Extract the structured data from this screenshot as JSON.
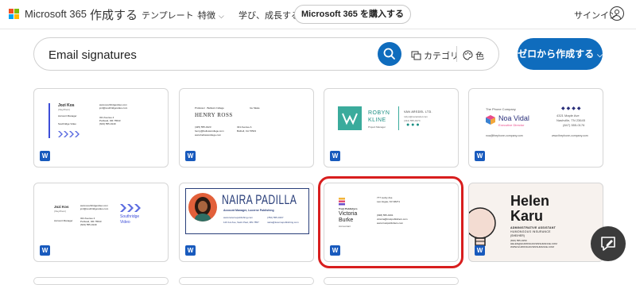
{
  "topbar": {
    "brand": "Microsoft 365",
    "create": "作成する",
    "nav": [
      "テンプレート",
      "特徴",
      "学び、成長する"
    ],
    "buy": "Microsoft 365 を購入する",
    "signin": "サインイン"
  },
  "search": {
    "value": "Email signatures",
    "filter_category": "カテゴリ",
    "filter_color": "色",
    "create_button": "ゼロから作成する"
  },
  "colors": {
    "accent": "#0f6cbd",
    "word": "#185abd",
    "highlight": "#d81e1e"
  },
  "cards": [
    {
      "name": "Jozi Kos",
      "sub": "(they/them)",
      "title": "Account Manager",
      "company": "Southridge Video",
      "web": "www.southridgevideo.com",
      "email": "jozi@southridgevideo.com",
      "addr1": "321 Avenue 4",
      "addr2": "Portland, OR 76543",
      "phone": "(623) 555-0149"
    },
    {
      "role": "Professor · Bellows College",
      "name": "HENRY ROSS",
      "tag": "Ice Skate",
      "phone": "(425) 555-0123",
      "email": "henry@bellowscollege.com",
      "web": "www.bellowscollege.com",
      "addr1": "321 Avenue A",
      "addr2": "Bothell, CA 76543"
    },
    {
      "name1": "ROBYN",
      "name2": "KLINE",
      "title": "Project Manager",
      "company": "VAN ARSDEL LTD.",
      "email": "robyn@vanarsdel.com",
      "phone": "(412) 555-0174"
    },
    {
      "company": "The Phone Company",
      "name": "Noa Vidal",
      "title": "Executive Director",
      "addr1": "4321 Maple Ave",
      "addr2": "Nashville, TN 23645",
      "phone": "(847) 555-0176",
      "email": "noa@thephone-company.com",
      "web": "www.thephone-company.com"
    },
    {
      "name": "Jozi Kos",
      "sub": "(they/them)",
      "title": "Account Manager",
      "web": "www.southridgevideo.com",
      "email": "jozi@southridgevideo.com",
      "addr1": "321 Avenue 4",
      "addr2": "Portland, OR 76543",
      "phone": "(623) 555-0149",
      "company1": "Southridge",
      "company2": "Video"
    },
    {
      "name": "NAIRA PADILLA",
      "title": "Account Manager, Lucerne Publishing",
      "web": "www.lucernepublishing.com",
      "phone": "(782) 555-0167",
      "addr": "123 1st Ave, Saint Paul, MN 7857",
      "email": "naira@lucernepublishing.com"
    },
    {
      "company": "Trust Publishers",
      "name1": "Victoria",
      "name2": "Burke",
      "title": "Accountant",
      "addr1": "777 Lucky Ave",
      "addr2": "Las Vegas, NV 38271",
      "phone": "(938) 555-0191",
      "email": "victoria@trustpublishers.com",
      "web": "www.trustpublishers.com"
    },
    {
      "name1": "Helen",
      "name2": "Karu",
      "title": "ADMINISTRATIVE ASSISTANT",
      "company": "HUMONGOUS INSURANCE",
      "pronoun": "(SHE/HER)",
      "phone": "(816) 555-0159",
      "email": "HELEN@HUMONGOUSINSURANCE.COM",
      "web": "WWW.HUMONGOUSINSURANCE.COM"
    }
  ],
  "word_badge": "W"
}
